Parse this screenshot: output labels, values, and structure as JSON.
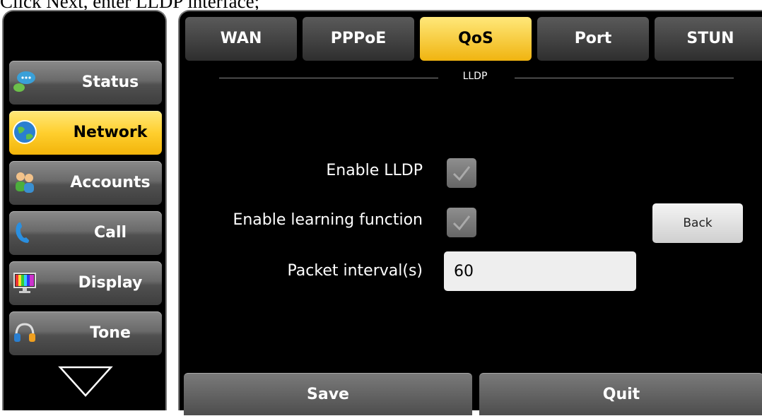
{
  "caption": "Click Next, enter LLDP interface;",
  "sidebar": {
    "items": [
      {
        "label": "Status",
        "icon": "status-chat-icon"
      },
      {
        "label": "Network",
        "icon": "globe-icon"
      },
      {
        "label": "Accounts",
        "icon": "users-icon"
      },
      {
        "label": "Call",
        "icon": "phone-handset-icon"
      },
      {
        "label": "Display",
        "icon": "monitor-icon"
      },
      {
        "label": "Tone",
        "icon": "headphones-icon"
      }
    ],
    "active": "Network"
  },
  "tabs": {
    "items": [
      "WAN",
      "PPPoE",
      "QoS",
      "Port",
      "STUN"
    ],
    "active": "QoS"
  },
  "section": {
    "title": "LLDP"
  },
  "form": {
    "enable_lldp_label": "Enable LLDP",
    "enable_lldp_checked": true,
    "enable_learning_label": "Enable learning function",
    "enable_learning_checked": true,
    "packet_interval_label": "Packet interval(s)",
    "packet_interval_value": "60"
  },
  "buttons": {
    "back": "Back",
    "save": "Save",
    "quit": "Quit"
  },
  "colors": {
    "accent_yellow": "#f5c518",
    "background": "#000000",
    "button_gray": "#5a5a5a"
  }
}
